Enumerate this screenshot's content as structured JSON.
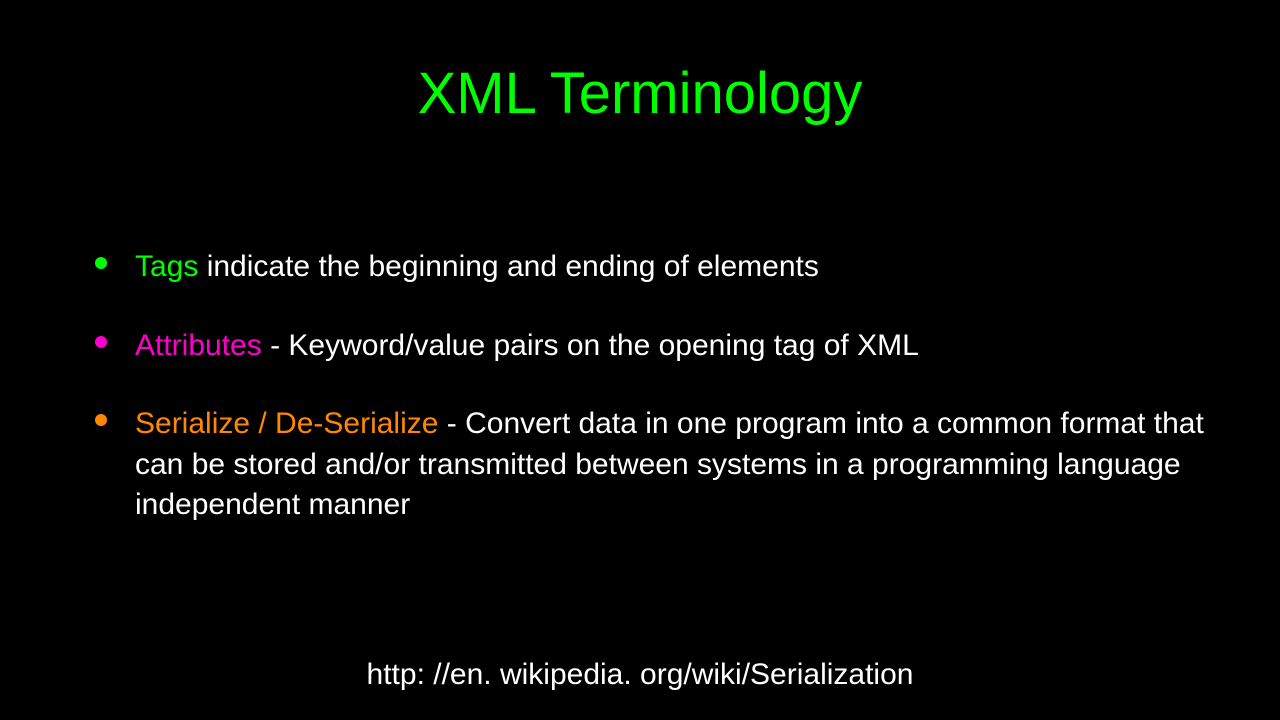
{
  "title": "XML Terminology",
  "bullets": [
    {
      "term": "Tags",
      "description": " indicate the beginning and ending of elements"
    },
    {
      "term": "Attributes",
      "description": " - Keyword/value pairs on the opening tag of XML"
    },
    {
      "term": "Serialize / De-Serialize",
      "description": " - Convert data in one program into a common format that can be stored and/or transmitted between systems in a programming language independent manner"
    }
  ],
  "footer_link": "http: //en. wikipedia. org/wiki/Serialization"
}
